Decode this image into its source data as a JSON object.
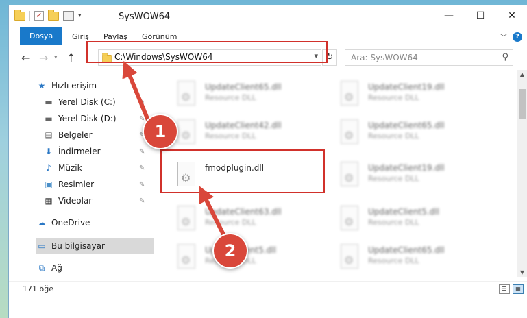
{
  "window": {
    "title": "SysWOW64",
    "controls": {
      "minimize": "—",
      "maximize": "☐",
      "close": "✕"
    }
  },
  "ribbon": {
    "tabs": [
      {
        "label": "Dosya"
      },
      {
        "label": "Giriş"
      },
      {
        "label": "Paylaş"
      },
      {
        "label": "Görünüm"
      }
    ],
    "help_label": "?"
  },
  "nav": {
    "address": "C:\\Windows\\SysWOW64",
    "search_placeholder": "Ara: SysWOW64"
  },
  "sidebar": {
    "items": [
      {
        "label": "Hızlı erişim",
        "icon": "star-icon"
      },
      {
        "label": "Yerel Disk (C:)",
        "icon": "drive-icon",
        "pinned": true
      },
      {
        "label": "Yerel Disk (D:)",
        "icon": "drive-icon",
        "pinned": true
      },
      {
        "label": "Belgeler",
        "icon": "document-icon",
        "pinned": true
      },
      {
        "label": "İndirmeler",
        "icon": "download-icon",
        "pinned": true
      },
      {
        "label": "Müzik",
        "icon": "music-icon",
        "pinned": true
      },
      {
        "label": "Resimler",
        "icon": "picture-icon",
        "pinned": true
      },
      {
        "label": "Videolar",
        "icon": "video-icon",
        "pinned": true
      },
      {
        "label": "OneDrive",
        "icon": "cloud-icon"
      },
      {
        "label": "Bu bilgisayar",
        "icon": "computer-icon",
        "selected": true
      },
      {
        "label": "Ağ",
        "icon": "network-icon"
      }
    ]
  },
  "files": [
    {
      "name": "UpdateClient65.dll",
      "type": "Resource DLL",
      "blurred": true
    },
    {
      "name": "UpdateClient19.dll",
      "type": "Resource DLL",
      "blurred": true
    },
    {
      "name": "UpdateClient42.dll",
      "type": "Resource DLL",
      "blurred": true
    },
    {
      "name": "UpdateClient65.dll",
      "type": "Resource DLL",
      "blurred": true
    },
    {
      "name": "fmodplugin.dll",
      "type": "",
      "blurred": false
    },
    {
      "name": "UpdateClient19.dll",
      "type": "Resource DLL",
      "blurred": true
    },
    {
      "name": "UpdateClient63.dll",
      "type": "Resource DLL",
      "blurred": true
    },
    {
      "name": "UpdateClient5.dll",
      "type": "Resource DLL",
      "blurred": true
    },
    {
      "name": "UpdateClient5.dll",
      "type": "Resource DLL",
      "blurred": true
    },
    {
      "name": "UpdateClient65.dll",
      "type": "Resource DLL",
      "blurred": true
    }
  ],
  "status": {
    "count": "171 öğe"
  },
  "callouts": {
    "step1": "1",
    "step2": "2"
  },
  "colors": {
    "accent": "#1979ca",
    "highlight": "#d1312b",
    "callout": "#d9473a",
    "selected_row": "#d9d9d9"
  }
}
